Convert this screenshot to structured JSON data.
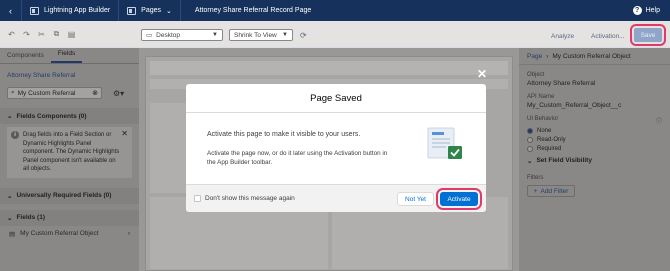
{
  "topbar": {
    "app_label": "Lightning App Builder",
    "pages_label": "Pages",
    "page_title": "Attorney Share Referral Record Page",
    "help_label": "Help"
  },
  "toolbar": {
    "device_select": "Desktop",
    "zoom_select": "Shrink To View",
    "analyze_label": "Analyze",
    "activation_label": "Activation...",
    "save_label": "Save"
  },
  "left_panel": {
    "tabs": [
      "Components",
      "Fields"
    ],
    "object_link": "Attorney Share Referral",
    "search_value": "My Custom Referral",
    "fields_components_header": "Fields Components (0)",
    "info_text": "Drag fields into a Field Section or Dynamic Highlights Panel component. The Dynamic Highlights Panel component isn't available on all objects.",
    "required_fields_header": "Universally Required Fields (0)",
    "fields_header": "Fields (1)",
    "field_item": "My Custom Referral Object"
  },
  "right_panel": {
    "breadcrumb_page": "Page",
    "breadcrumb_current": "My Custom Referral Object",
    "object_label": "Object",
    "object_value": "Attorney Share Referral",
    "api_name_label": "API Name",
    "api_name_value": "My_Custom_Referral_Object__c",
    "ui_behavior_label": "UI Behavior",
    "ui_options": [
      "None",
      "Read-Only",
      "Required"
    ],
    "visibility_header": "Set Field Visibility",
    "filters_label": "Filters",
    "add_filter_label": "Add Filter"
  },
  "modal": {
    "title": "Page Saved",
    "message": "Activate this page to make it visible to your users.",
    "submessage": "Activate the page now, or do it later using the Activation button in the App Builder toolbar.",
    "checkbox_label": "Don't show this message again",
    "not_yet_label": "Not Yet",
    "activate_label": "Activate"
  }
}
